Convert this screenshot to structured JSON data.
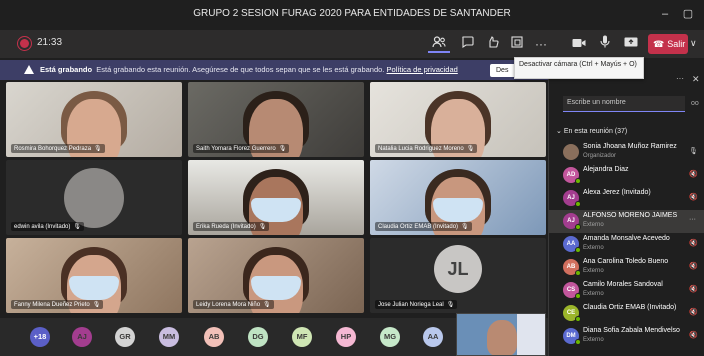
{
  "window": {
    "title": "GRUPO 2 SESION FURAG 2020 PARA ENTIDADES DE SANTANDER",
    "minimize_glyph": "–",
    "maximize_glyph": "▢"
  },
  "toolbar": {
    "timer": "21:33",
    "leave_label": "Salir",
    "icons": [
      "participants-icon",
      "chat-icon",
      "reactions-icon",
      "breakout-rooms-icon",
      "more-icon",
      "camera-icon",
      "mic-icon",
      "share-screen-icon",
      "leave-phone-icon"
    ]
  },
  "banner": {
    "bold": "Está grabando",
    "text": "Está grabando esta reunión. Asegúrese de que todos sepan que se les está grabando.",
    "link": "Política de privacidad",
    "button": "Des"
  },
  "tooltip": {
    "text": "Desactivar cámara (Ctrl + Mayús + O)"
  },
  "tiles": [
    {
      "name": "Rosmira Bohorquez Pedraza",
      "type": "video"
    },
    {
      "name": "Saith Yomara Florez Guerrero",
      "type": "video"
    },
    {
      "name": "Natalia Lucia Rodriguez Moreno",
      "type": "video"
    },
    {
      "name": "edwin avila (Invitado)",
      "type": "avatar"
    },
    {
      "name": "Erika Rueda (Invitado)",
      "type": "video"
    },
    {
      "name": "Claudia Ortiz EMAB (Invitado)",
      "type": "video"
    },
    {
      "name": "Fanny Milena Dueñez Prieto",
      "type": "video"
    },
    {
      "name": "Leidy Lorena Mora Niño",
      "type": "video"
    },
    {
      "name": "Jose Julian Noriega Leal",
      "type": "initials",
      "initials": "JL"
    }
  ],
  "overflow_count": "+18",
  "bottom_avatars": [
    {
      "initials": "AJ",
      "color": "#a33d8f"
    },
    {
      "initials": "GR",
      "color": "#d3d3d3"
    },
    {
      "initials": "MM",
      "color": "#c9bde0"
    },
    {
      "initials": "AB",
      "color": "#f2c0b8"
    },
    {
      "initials": "DG",
      "color": "#bfe3c3"
    },
    {
      "initials": "MF",
      "color": "#cfe6b4"
    },
    {
      "initials": "HP",
      "color": "#f5b8d3"
    },
    {
      "initials": "MG",
      "color": "#c6e8c9"
    },
    {
      "initials": "AA",
      "color": "#b9c8ec"
    }
  ],
  "panel": {
    "heading": "",
    "more": "···",
    "close": "✕",
    "search_placeholder": "Escribe un nombre",
    "section": "En esta reunión (37)",
    "members": [
      {
        "name": "Sonia Jhoana Muñoz Ramirez",
        "role": "Organizador",
        "initials": "",
        "color": "#8a6f5c",
        "mic": "on"
      },
      {
        "name": "Alejandra Diaz",
        "role": "",
        "initials": "AD",
        "color": "#c2569c",
        "mic": "off"
      },
      {
        "name": "Alexa Jerez (Invitado)",
        "role": "",
        "initials": "AJ",
        "color": "#a33d8f",
        "mic": "off"
      },
      {
        "name": "ALFONSO MORENO JAIMES",
        "role": "Externo",
        "initials": "AJ",
        "color": "#a33d8f",
        "mic": "more"
      },
      {
        "name": "Amanda Monsalve Acevedo",
        "role": "Externo",
        "initials": "AA",
        "color": "#5b6ad0",
        "mic": "off"
      },
      {
        "name": "Ana Carolina Toledo Bueno",
        "role": "Externo",
        "initials": "AB",
        "color": "#d16f5e",
        "mic": "off"
      },
      {
        "name": "Camilo Morales Sandoval",
        "role": "Externo",
        "initials": "CS",
        "color": "#c2569c",
        "mic": "off"
      },
      {
        "name": "Claudia Ortiz EMAB (Invitado)",
        "role": "",
        "initials": "CE",
        "color": "#9bb52a",
        "mic": "off"
      },
      {
        "name": "Diana Sofia Zabala Mendivelso",
        "role": "Externo",
        "initials": "DM",
        "color": "#5b6ad0",
        "mic": "off"
      }
    ]
  }
}
